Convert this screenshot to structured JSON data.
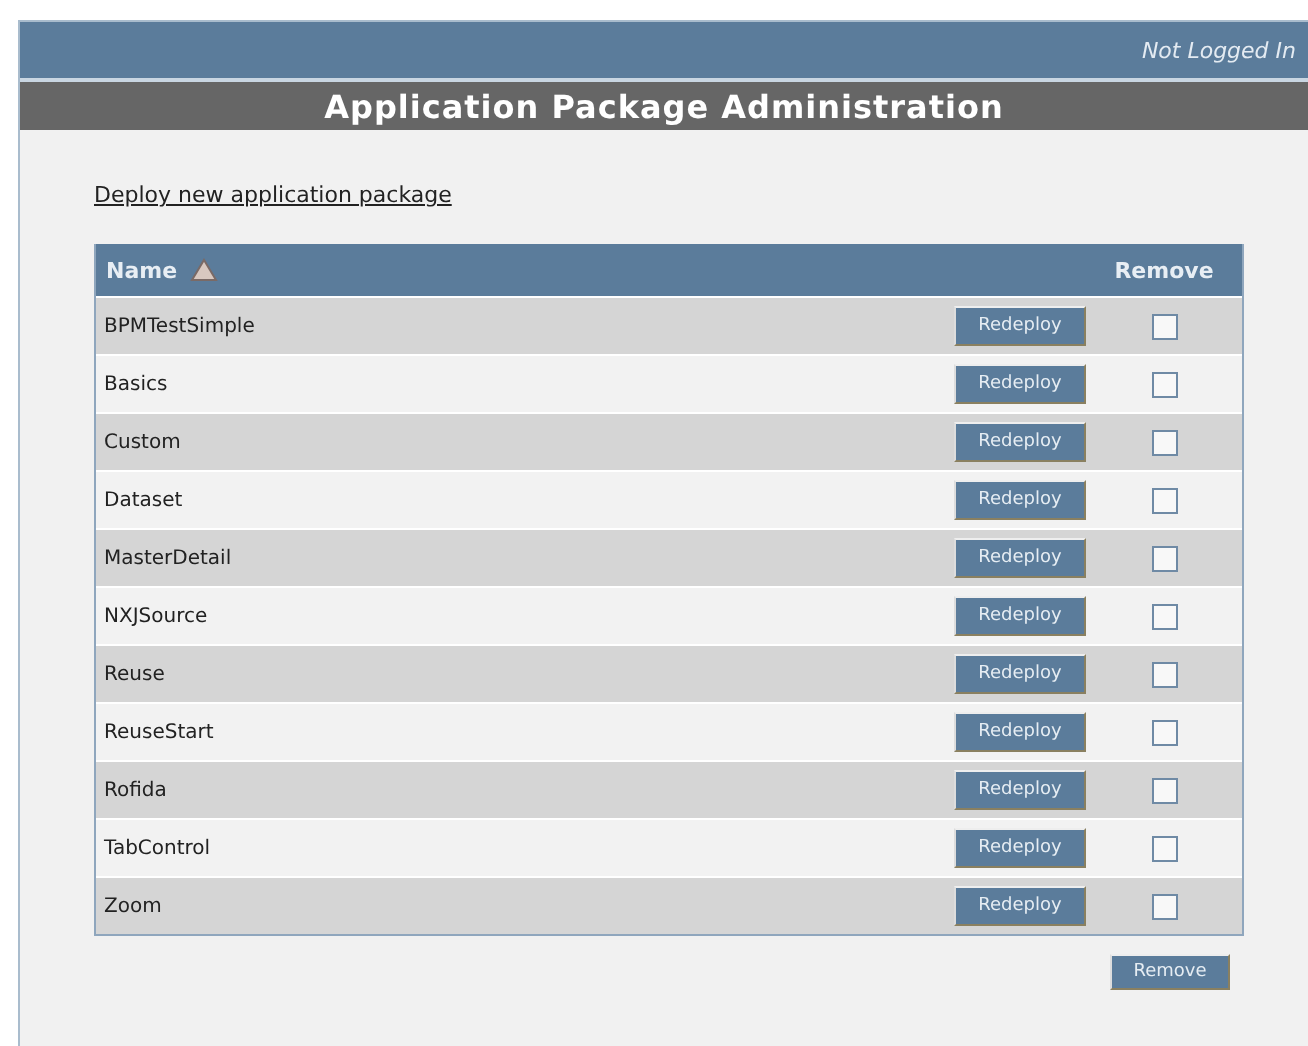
{
  "header": {
    "login_status": "Not Logged In"
  },
  "page_title": "Application Package Administration",
  "deploy_link": "Deploy new application package",
  "table": {
    "columns": [
      {
        "label": "Name",
        "sorted": true
      },
      {
        "label": "Remove",
        "sorted": false
      }
    ],
    "rows": [
      {
        "name": "BPMTestSimple",
        "button": "Redeploy",
        "checked": false
      },
      {
        "name": "Basics",
        "button": "Redeploy",
        "checked": false
      },
      {
        "name": "Custom",
        "button": "Redeploy",
        "checked": false
      },
      {
        "name": "Dataset",
        "button": "Redeploy",
        "checked": false
      },
      {
        "name": "MasterDetail",
        "button": "Redeploy",
        "checked": false
      },
      {
        "name": "NXJSource",
        "button": "Redeploy",
        "checked": false
      },
      {
        "name": "Reuse",
        "button": "Redeploy",
        "checked": false
      },
      {
        "name": "ReuseStart",
        "button": "Redeploy",
        "checked": false
      },
      {
        "name": "Rofida",
        "button": "Redeploy",
        "checked": false
      },
      {
        "name": "TabControl",
        "button": "Redeploy",
        "checked": false
      },
      {
        "name": "Zoom",
        "button": "Redeploy",
        "checked": false
      }
    ]
  },
  "remove_button": "Remove"
}
